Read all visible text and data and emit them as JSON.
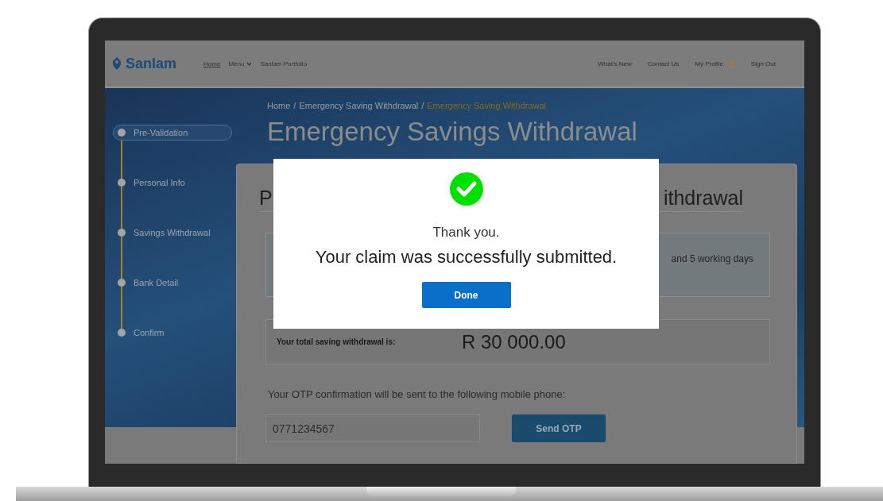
{
  "nav": {
    "brand": "Sanlam",
    "links": [
      {
        "label": "Home",
        "dropdown": false
      },
      {
        "label": "Menu",
        "dropdown": true
      },
      {
        "label": "Sanlam Portfolio",
        "dropdown": false
      }
    ],
    "right_links": [
      {
        "label": "What's New",
        "kind": "link"
      },
      {
        "label": "Contact Us",
        "kind": "link"
      },
      {
        "label": "My Profile",
        "kind": "profile"
      },
      {
        "label": "Sign Out",
        "kind": "link"
      }
    ]
  },
  "steps": [
    {
      "label": "Pre-Validation",
      "selected": true
    },
    {
      "label": "Personal Info",
      "selected": false
    },
    {
      "label": "Savings Withdrawal",
      "selected": false
    },
    {
      "label": "Bank Detail",
      "selected": false
    },
    {
      "label": "Confirm",
      "selected": false
    }
  ],
  "breadcrumb": {
    "separator": "/",
    "items": [
      {
        "label": "Home",
        "selected": false
      },
      {
        "label": "Emergency Saving Withdrawal",
        "selected": false
      },
      {
        "label": "Emergency Saving Withdrawal",
        "selected": true
      }
    ]
  },
  "page_title": "Emergency Savings Withdrawal",
  "card": {
    "title_start": "P",
    "title_end": "ithdrawal",
    "notice": "and 5 working days",
    "total_label": "Your total saving withdrawal is:",
    "total_value": "R 30 000.00",
    "otp_prompt": "Your OTP confirmation will be sent to the following mobile phone:",
    "phone": "0771234567",
    "send_button": "Send OTP"
  },
  "modal": {
    "message": "Thank you.",
    "detail": "Your claim was successfully submitted.",
    "button": "Done"
  }
}
